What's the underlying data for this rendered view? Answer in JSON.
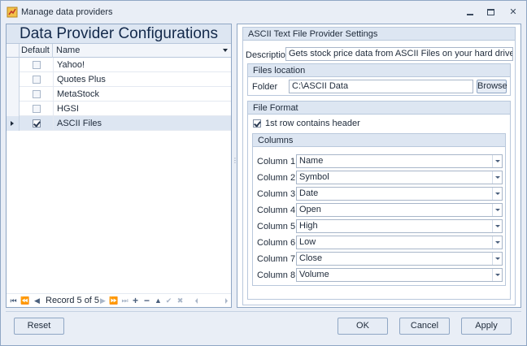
{
  "window": {
    "title": "Manage data providers",
    "min_glyph": "—",
    "close_glyph": "✕"
  },
  "left": {
    "title": "Data Provider Configurations",
    "columns": [
      "Default",
      "Name"
    ],
    "rows": [
      {
        "name": "Yahoo!",
        "default": false
      },
      {
        "name": "Quotes Plus",
        "default": false
      },
      {
        "name": "MetaStock",
        "default": false
      },
      {
        "name": "HGSI",
        "default": false
      },
      {
        "name": "ASCII Files",
        "default": true
      }
    ],
    "selected_index": 4,
    "navigator": {
      "first": "⏮",
      "prev_page": "⏪",
      "prev": "◀",
      "record_text": "Record 5 of 5",
      "next": "▶",
      "next_page": "⏩",
      "last": "⏭",
      "append": "+",
      "delete": "−",
      "edit": "▲",
      "end_edit": "✔",
      "cancel_edit": "✖"
    }
  },
  "right": {
    "group_title": "ASCII Text File Provider Settings",
    "description_label": "Description",
    "description_value": "Gets stock price data from ASCII Files on your hard drive",
    "files_location": {
      "title": "Files location",
      "folder_label": "Folder",
      "folder_value": "C:\\ASCII Data",
      "browse_label": "Browse"
    },
    "file_format": {
      "title": "File Format",
      "header_checkbox_label": "1st row contains header",
      "header_checked": true,
      "columns_title": "Columns",
      "columns": [
        {
          "label": "Column 1",
          "value": "Name"
        },
        {
          "label": "Column 2",
          "value": "Symbol"
        },
        {
          "label": "Column 3",
          "value": "Date"
        },
        {
          "label": "Column 4",
          "value": "Open"
        },
        {
          "label": "Column 5",
          "value": "High"
        },
        {
          "label": "Column 6",
          "value": "Low"
        },
        {
          "label": "Column 7",
          "value": "Close"
        },
        {
          "label": "Column 8",
          "value": "Volume"
        }
      ]
    }
  },
  "footer": {
    "reset_label": "Reset",
    "ok_label": "OK",
    "cancel_label": "Cancel",
    "apply_label": "Apply"
  }
}
